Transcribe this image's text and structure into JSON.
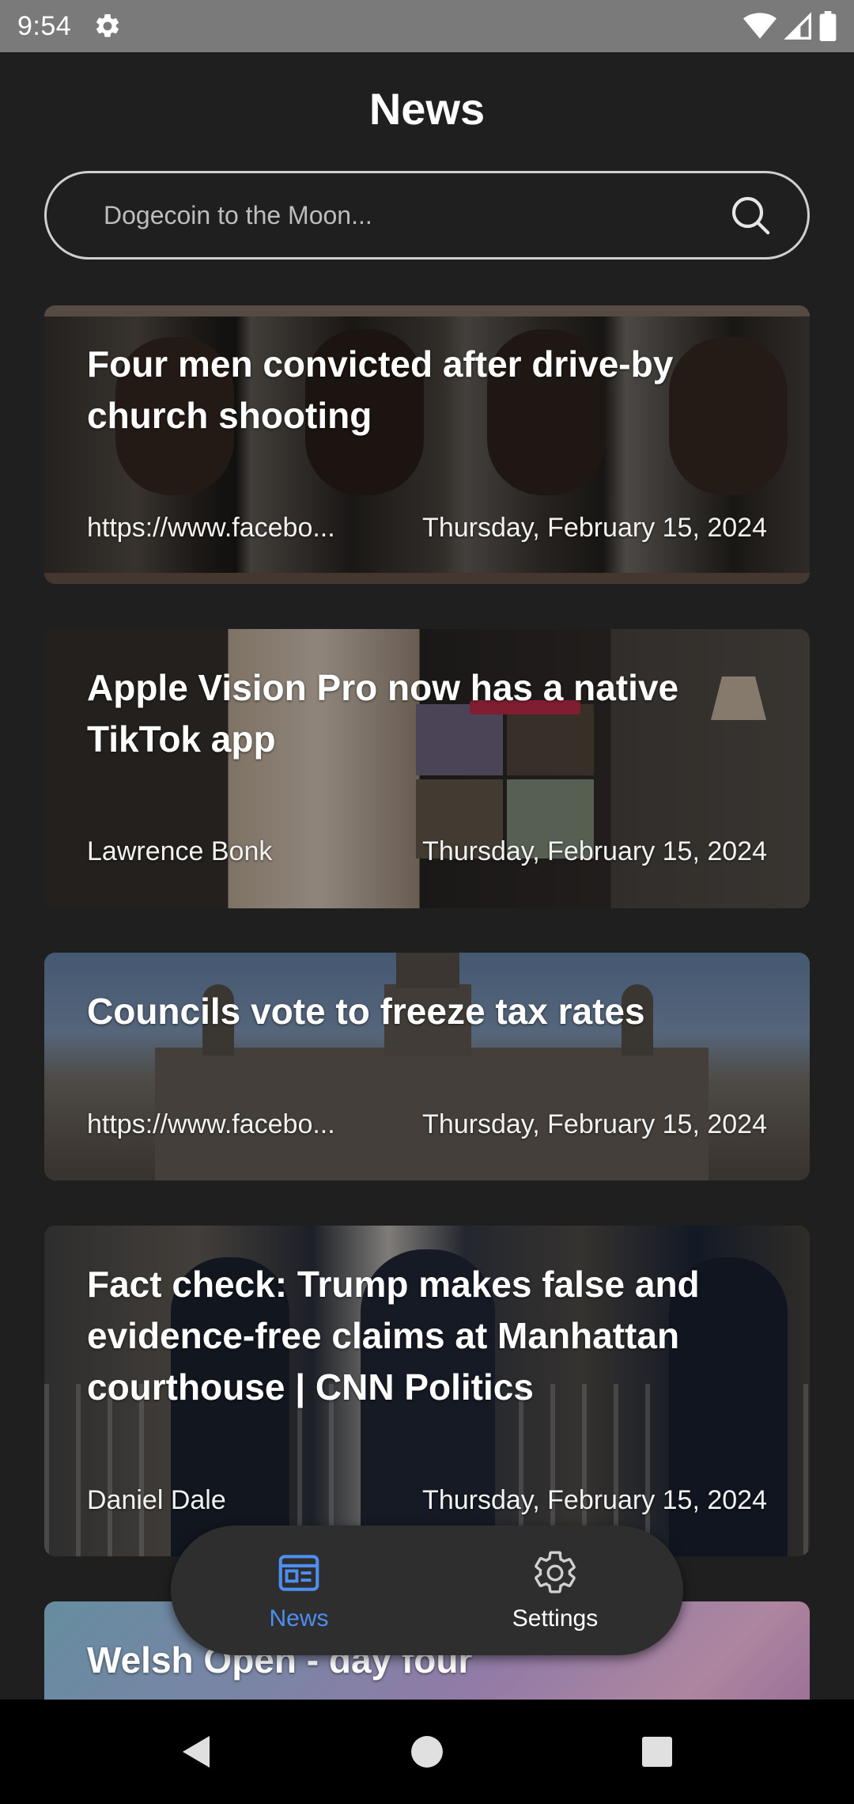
{
  "status_bar": {
    "time": "9:54",
    "icons": [
      "settings-gear-icon",
      "wifi-icon",
      "cellular-signal-icon",
      "battery-icon"
    ]
  },
  "header": {
    "title": "News"
  },
  "search": {
    "placeholder": "Dogecoin to the Moon...",
    "value": ""
  },
  "articles": [
    {
      "title": "Four men convicted after drive-by church shooting",
      "source": "https://www.facebo...",
      "date": "Thursday, February 15, 2024"
    },
    {
      "title": "Apple Vision Pro now has a native TikTok app",
      "source": "Lawrence Bonk",
      "date": "Thursday, February 15, 2024"
    },
    {
      "title": "Councils vote to freeze tax rates",
      "source": "https://www.facebo...",
      "date": "Thursday, February 15, 2024"
    },
    {
      "title": "Fact check: Trump makes false and evidence-free claims at Manhattan courthouse | CNN Politics",
      "source": "Daniel Dale",
      "date": "Thursday, February 15, 2024"
    },
    {
      "title": "Welsh Open - day four",
      "source": "",
      "date": ""
    }
  ],
  "bottom_nav": {
    "items": [
      {
        "label": "News",
        "icon": "newspaper-icon",
        "active": true
      },
      {
        "label": "Settings",
        "icon": "gear-icon",
        "active": false
      }
    ],
    "active_color": "#4d8ef0"
  },
  "system_nav": {
    "buttons": [
      "back-icon",
      "home-icon",
      "recents-icon"
    ]
  }
}
